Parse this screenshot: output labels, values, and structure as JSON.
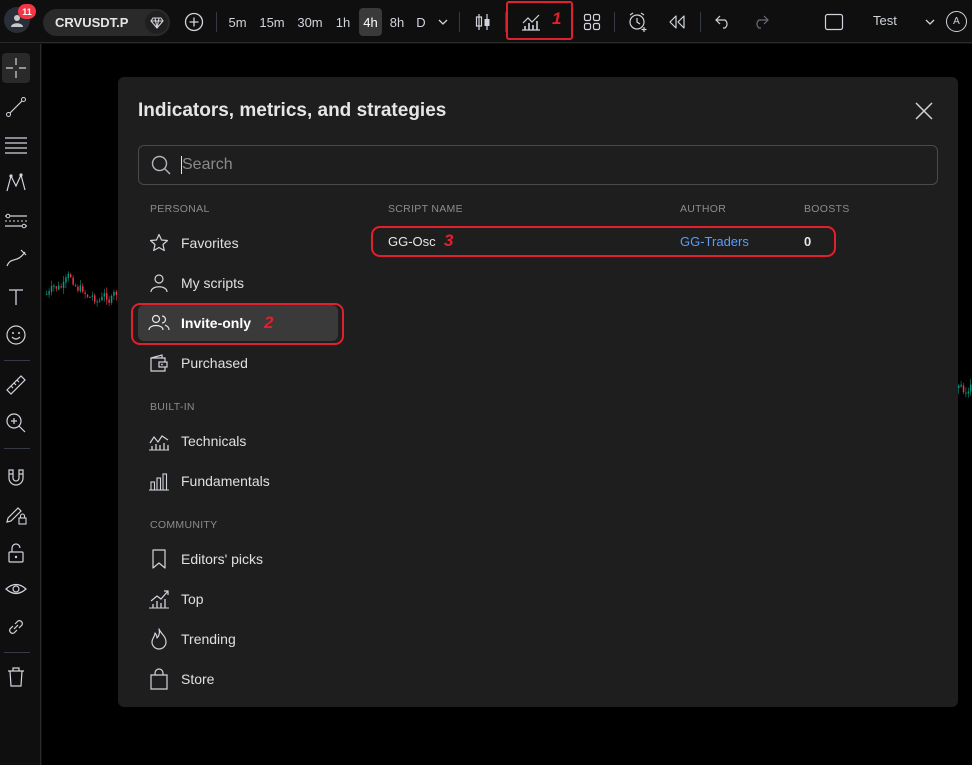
{
  "topbar": {
    "notification_count": "11",
    "symbol": "CRVUSDT.P",
    "intervals": [
      "5m",
      "15m",
      "30m",
      "1h",
      "4h",
      "8h",
      "D"
    ],
    "active_interval": "4h",
    "layout_name": "Test",
    "account_initial": "A"
  },
  "annotations": {
    "step1": "1",
    "step2": "2",
    "step3": "3",
    "highlight_color": "#e0202d"
  },
  "dialog": {
    "title": "Indicators, metrics, and strategies",
    "search_placeholder": "Search",
    "sections": {
      "personal": "PERSONAL",
      "builtin": "BUILT-IN",
      "community": "COMMUNITY"
    },
    "nav": {
      "favorites": "Favorites",
      "my_scripts": "My scripts",
      "invite_only": "Invite-only",
      "purchased": "Purchased",
      "technicals": "Technicals",
      "fundamentals": "Fundamentals",
      "editors_picks": "Editors' picks",
      "top": "Top",
      "trending": "Trending",
      "store": "Store"
    },
    "columns": {
      "script_name": "SCRIPT NAME",
      "author": "AUTHOR",
      "boosts": "BOOSTS"
    },
    "scripts": [
      {
        "name": "GG-Osc",
        "author": "GG-Traders",
        "boosts": "0"
      }
    ],
    "colors": {
      "author_link": "#5b9cf6",
      "active_bg": "#3a3a3a",
      "panel_bg": "#1e1e1e"
    }
  }
}
